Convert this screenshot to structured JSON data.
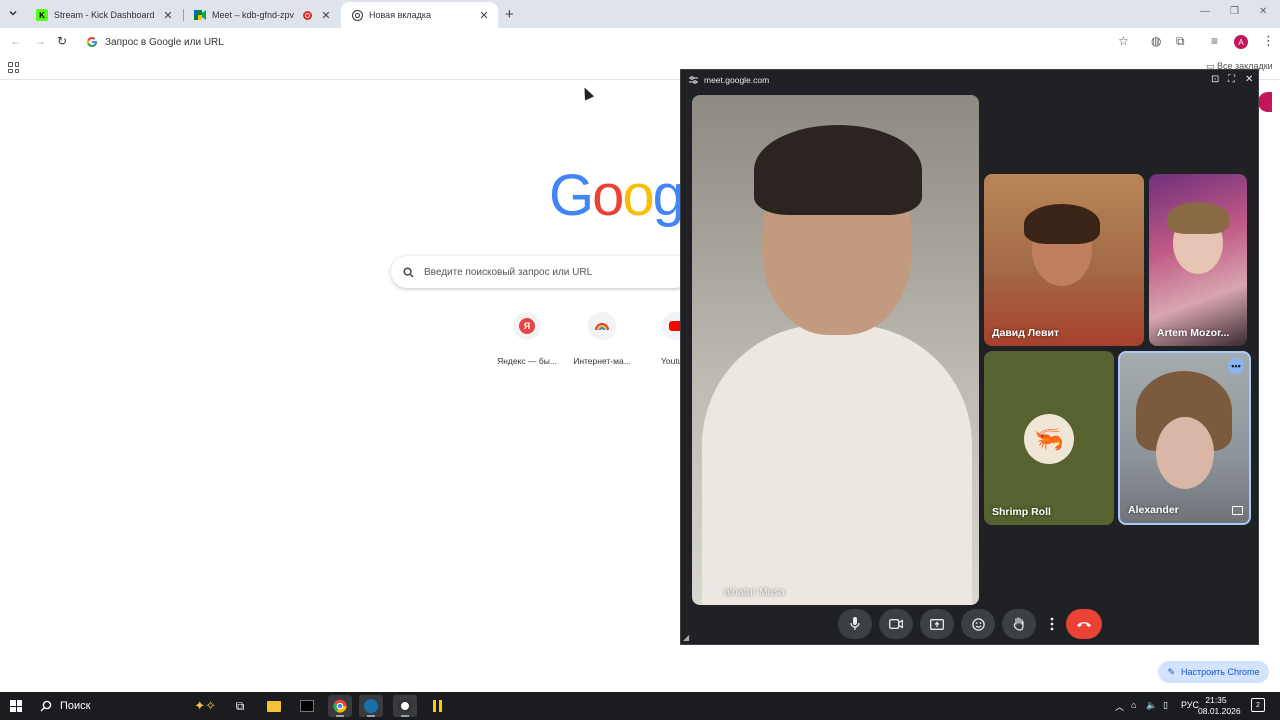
{
  "browser": {
    "tabs": [
      {
        "title": "Stream - Kick Dashboard",
        "favicon": "kick-icon",
        "color": "#53fc18"
      },
      {
        "title": "Meet – kdb-gfnd-zpv",
        "favicon": "meet-icon",
        "recording": true
      },
      {
        "title": "Новая вкладка",
        "favicon": "chrome-icon",
        "active": true
      }
    ],
    "omnibox_placeholder": "Запрос в Google или URL",
    "all_bookmarks_label": "Все закладки",
    "profile_initial": "А"
  },
  "ntp": {
    "logo_letters": [
      "G",
      "o",
      "o",
      "g"
    ],
    "search_placeholder": "Введите поисковый запрос или URL",
    "shortcuts": [
      {
        "label": "Яндекс — бы...",
        "icon": "yandex-icon"
      },
      {
        "label": "Интернет-ма...",
        "icon": "rainbow-icon"
      },
      {
        "label": "Youtu",
        "icon": "youtube-icon"
      }
    ],
    "customize_label": "Настроить Chrome"
  },
  "meet": {
    "domain": "meet.google.com",
    "participants": [
      {
        "name": "alnatur Musa",
        "pinned": true
      },
      {
        "name": "Давид Левит"
      },
      {
        "name": "Artem Mozor..."
      },
      {
        "name": "Shrimp Roll"
      },
      {
        "name": "Alexander",
        "active_speaker": true
      }
    ],
    "controls": [
      "microphone-icon",
      "camera-icon",
      "present-icon",
      "emoji-icon",
      "raise-hand-icon",
      "more-options-icon",
      "hang-up-icon"
    ],
    "accent": "#8ab4f8",
    "hangup_color": "#ea4335"
  },
  "taskbar": {
    "search_label": "Поиск",
    "language": "РУС",
    "time": "21:35",
    "date": "08.01.2026",
    "notifications": "2"
  }
}
